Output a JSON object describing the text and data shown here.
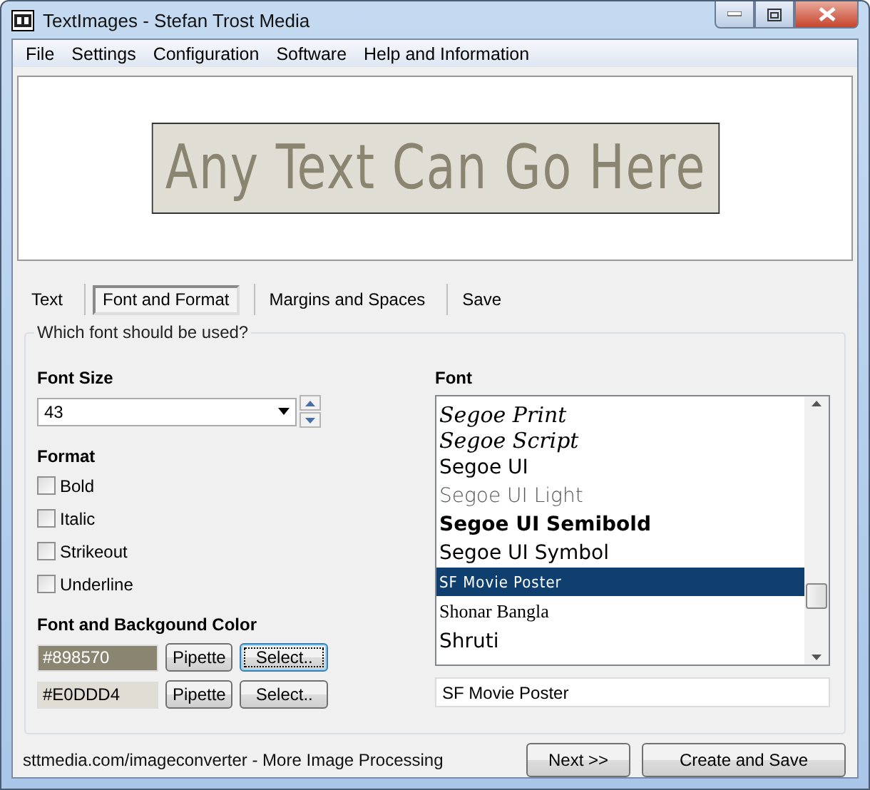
{
  "window": {
    "title": "TextImages - Stefan Trost Media"
  },
  "menu": [
    "File",
    "Settings",
    "Configuration",
    "Software",
    "Help and Information"
  ],
  "preview": {
    "text": "Any Text Can Go Here"
  },
  "tabs": [
    {
      "label": "Text",
      "selected": false
    },
    {
      "label": "Font and Format",
      "selected": true
    },
    {
      "label": "Margins and Spaces",
      "selected": false
    },
    {
      "label": "Save",
      "selected": false
    }
  ],
  "group": {
    "legend": "Which font should be used?"
  },
  "font_size": {
    "label": "Font Size",
    "value": "43"
  },
  "format": {
    "label": "Format",
    "options": [
      {
        "label": "Bold",
        "checked": false
      },
      {
        "label": "Italic",
        "checked": false
      },
      {
        "label": "Strikeout",
        "checked": false
      },
      {
        "label": "Underline",
        "checked": false
      }
    ]
  },
  "colors": {
    "label": "Font and Backgound Color",
    "rows": [
      {
        "value": "#898570",
        "color": "#898570",
        "pipette": "Pipette",
        "select": "Select..",
        "focused": true
      },
      {
        "value": "#E0DDD4",
        "color": "#e0ddd4",
        "pipette": "Pipette",
        "select": "Select..",
        "focused": false
      }
    ]
  },
  "font": {
    "label": "Font",
    "items": [
      {
        "name": "Segoe Print",
        "kind": "script",
        "selected": false
      },
      {
        "name": "Segoe Script",
        "kind": "script",
        "selected": false
      },
      {
        "name": "Segoe UI",
        "kind": "regular",
        "selected": false
      },
      {
        "name": "Segoe UI Light",
        "kind": "light",
        "selected": false
      },
      {
        "name": "Segoe UI Semibold",
        "kind": "semibold",
        "selected": false
      },
      {
        "name": "Segoe UI Symbol",
        "kind": "regular",
        "selected": false
      },
      {
        "name": "SF Movie Poster",
        "kind": "condensed",
        "selected": true
      },
      {
        "name": "Shonar Bangla",
        "kind": "serif",
        "selected": false
      },
      {
        "name": "Shruti",
        "kind": "regular",
        "selected": false
      }
    ],
    "value": "SF Movie Poster"
  },
  "footer": {
    "link": "sttmedia.com/imageconverter - More Image Processing",
    "buttons": [
      "Next >>",
      "Create and Save"
    ]
  }
}
